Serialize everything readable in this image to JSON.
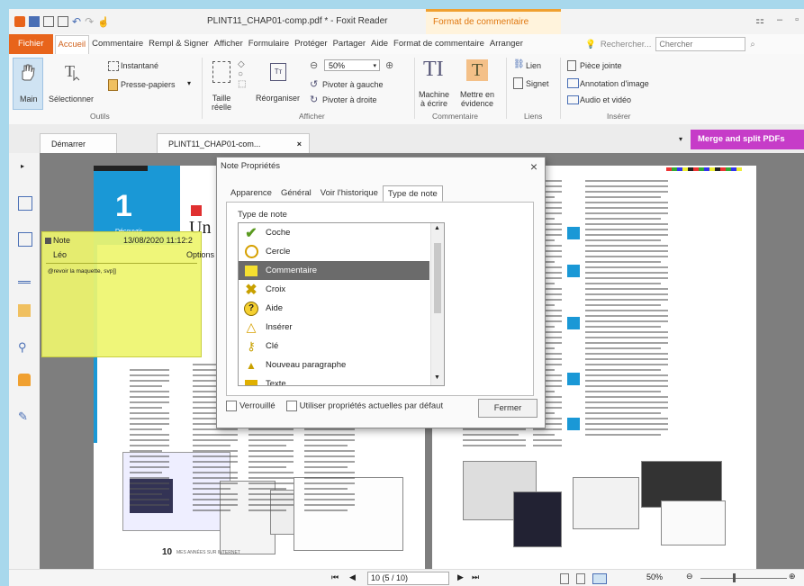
{
  "window": {
    "title": "PLINT11_CHAP01-comp.pdf * - Foxit Reader",
    "context_tab": "Format de commentaire"
  },
  "menu": {
    "items": [
      "Fichier",
      "Accueil",
      "Commentaire",
      "Rempl & Signer",
      "Afficher",
      "Formulaire",
      "Protéger",
      "Partager",
      "Aide",
      "Format de commentaire",
      "Arranger"
    ],
    "search_label": "Rechercher...",
    "search_placeholder": "Chercher"
  },
  "ribbon": {
    "main": "Main",
    "select": "Sélectionner",
    "snapshot": "Instantané",
    "clipboard": "Presse-papiers",
    "tools_group": "Outils",
    "page_size": "Taille réelle",
    "reorganize": "Réorganiser",
    "zoom": "50%",
    "rotate_left": "Pivoter à gauche",
    "rotate_right": "Pivoter à droite",
    "view_group": "Afficher",
    "typewriter": "Machine à écrire",
    "highlight": "Mettre en évidence",
    "comment_group": "Commentaire",
    "link": "Lien",
    "bookmark": "Signet",
    "links_group": "Liens",
    "attachment": "Pièce jointe",
    "audio_annot": "Annotation d'image",
    "audio_video": "Audio et vidéo",
    "insert_group": "Insérer"
  },
  "tabs": {
    "start": "Démarrer",
    "doc": "PLINT11_CHAP01-com...",
    "merge": "Merge and split PDFs"
  },
  "note": {
    "header": "Note",
    "date": "13/08/2020 11:12:2",
    "author": "Léo",
    "options": "Options",
    "body": "@revoir la maquette, svp]]"
  },
  "page": {
    "number": "1",
    "label": "Découvrir",
    "title_partial": "Un",
    "page_num": "10",
    "footer": "MES ANNÉES SUR INTERNET"
  },
  "dialog": {
    "title": "Note Propriétés",
    "tabs": [
      "Apparence",
      "Général",
      "Voir l'historique",
      "Type de note"
    ],
    "selected_tab": 3,
    "list_label": "Type de note",
    "items": [
      "Coche",
      "Cercle",
      "Commentaire",
      "Croix",
      "Aide",
      "Insérer",
      "Clé",
      "Nouveau paragraphe",
      "Texte"
    ],
    "selected_item": 2,
    "lock": "Verrouillé",
    "use_default": "Utiliser propriétés actuelles par défaut",
    "close": "Fermer"
  },
  "status": {
    "page": "10 (5 / 10)",
    "zoom": "50%"
  },
  "colors": {
    "accent": "#e8641b",
    "merge": "#c63cc8",
    "note": "#eef56e"
  }
}
